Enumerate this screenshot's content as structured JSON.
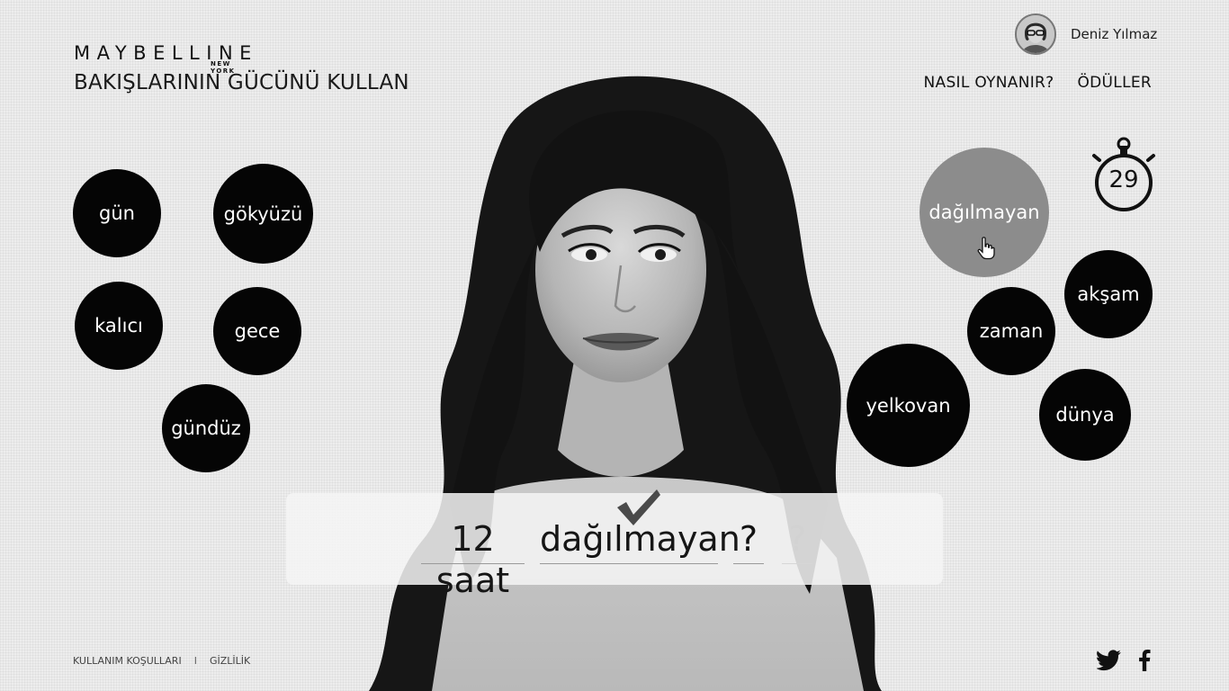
{
  "header": {
    "logo": "MAYBELLINE",
    "logo_sub": "NEW YORK",
    "tagline": "BAKIŞLARININ GÜCÜNÜ KULLAN",
    "user_name": "Deniz Yılmaz",
    "nav": [
      "NASIL OYNANIR?",
      "ÖDÜLLER"
    ]
  },
  "timer": {
    "seconds": "29"
  },
  "words": {
    "left": [
      "gün",
      "gökyüzü",
      "kalıcı",
      "gece",
      "gündüz"
    ],
    "right": [
      "dağılmayan",
      "akşam",
      "zaman",
      "yelkovan",
      "dünya"
    ],
    "selected": "dağılmayan"
  },
  "answer": {
    "slots": [
      "12 saat",
      "dağılmayan",
      "?",
      "?"
    ]
  },
  "footer": {
    "terms": "KULLANIM KOŞULLARI",
    "separator": "I",
    "privacy": "GİZLİLİK"
  },
  "colors": {
    "bubble": "#050505",
    "bubble_selected": "#8c8c8c",
    "background": "#ededed"
  }
}
